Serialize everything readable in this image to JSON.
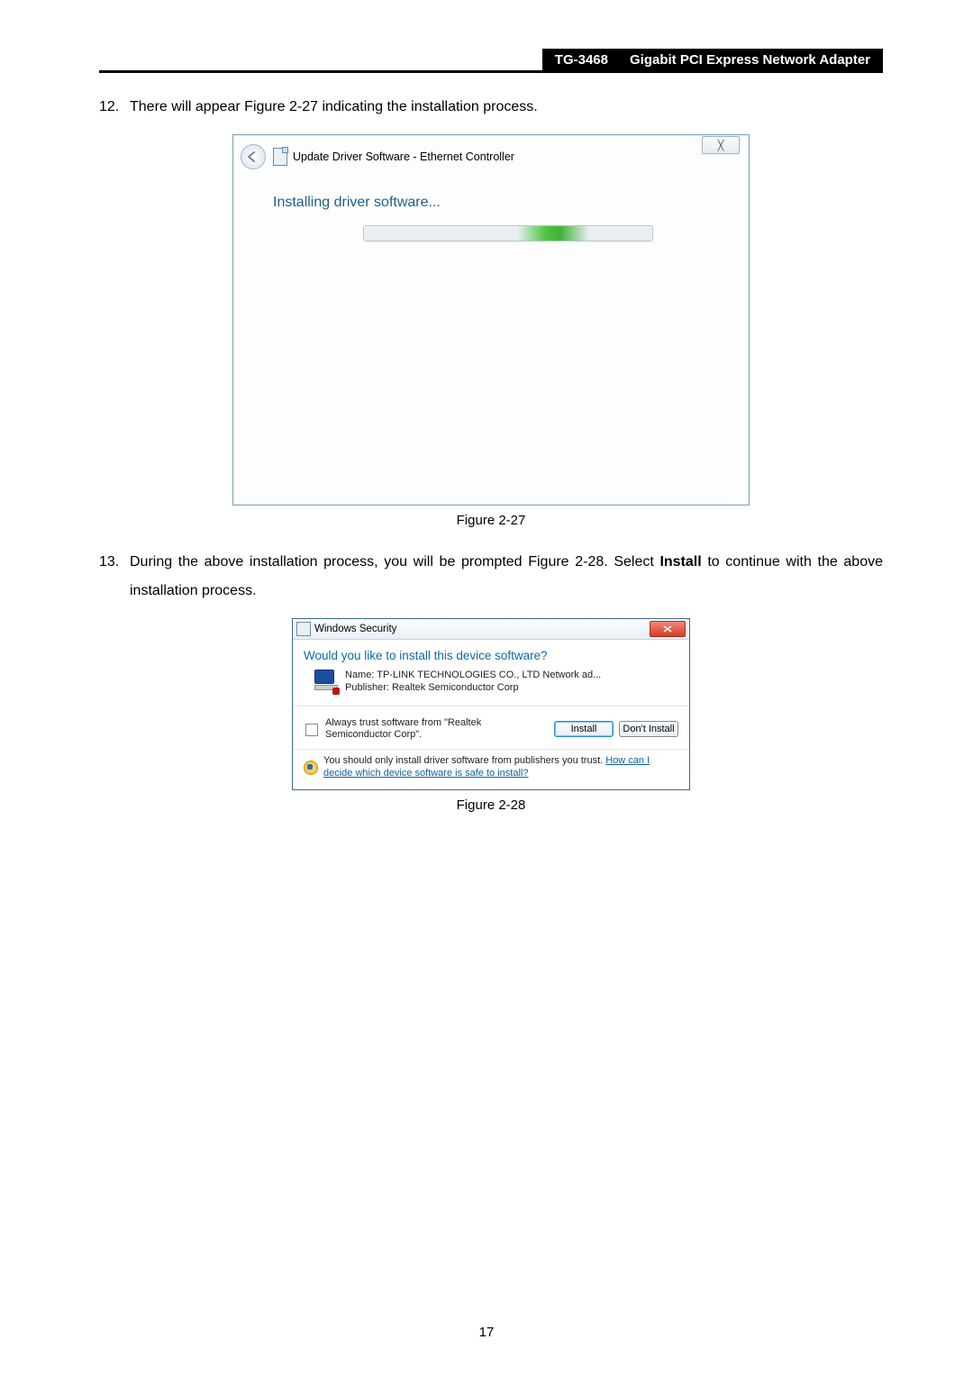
{
  "header": {
    "model": "TG-3468",
    "product": "Gigabit PCI Express Network Adapter"
  },
  "steps": {
    "s12": {
      "num": "12.",
      "text": "There will appear Figure 2-27 indicating the installation process."
    },
    "s13": {
      "num": "13.",
      "text_before_bold": "During the above installation process, you will be prompted Figure 2-28. Select ",
      "bold": "Install",
      "text_after_bold": " to continue with the above installation process."
    }
  },
  "captions": {
    "fig27": "Figure 2-27",
    "fig28": "Figure 2-28"
  },
  "dlg1": {
    "title": "Update Driver Software -  Ethernet Controller",
    "close_glyph": "╳",
    "heading": "Installing driver software..."
  },
  "dlg2": {
    "title": "Windows Security",
    "heading": "Would you like to install this device software?",
    "device_name": "Name: TP-LINK TECHNOLOGIES CO., LTD Network ad...",
    "device_pub": "Publisher: Realtek Semiconductor Corp",
    "trust_text": "Always trust software from \"Realtek Semiconductor Corp\".",
    "install_btn": "Install",
    "dont_btn": "Don't Install",
    "foot_text_plain": "You should only install driver software from publishers you trust.  ",
    "foot_link": "How can I decide which device software is safe to install?"
  },
  "page_number": "17"
}
